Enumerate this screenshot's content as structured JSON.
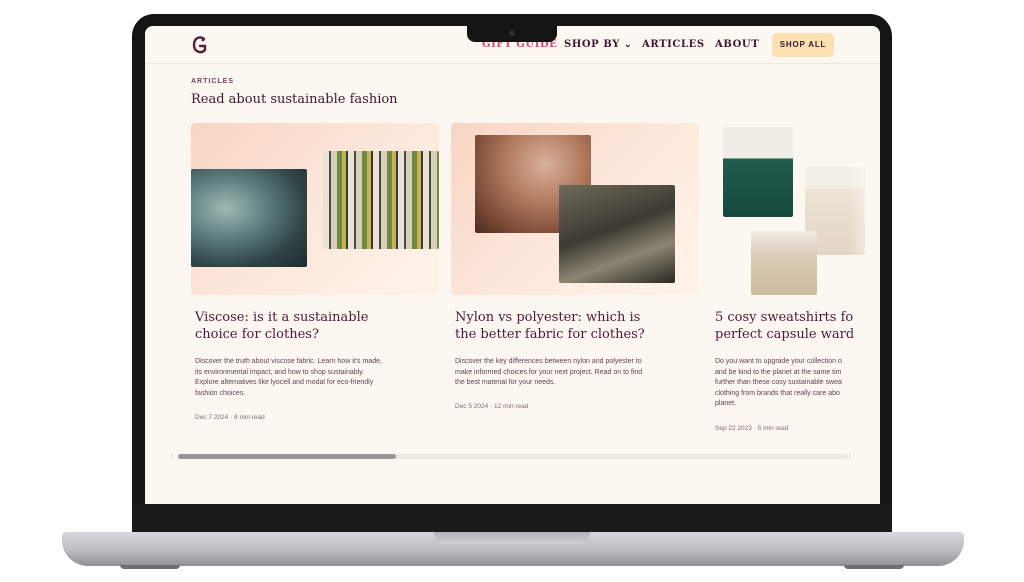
{
  "nav": {
    "items": [
      "GIFT GUIDE",
      "SHOP BY",
      "ARTICLES",
      "ABOUT"
    ],
    "cta": "SHOP ALL",
    "active_color": "#d9466f"
  },
  "section": {
    "eyebrow": "ARTICLES",
    "title": "Read about sustainable fashion"
  },
  "articles": [
    {
      "title": "Viscose: is it a sustainable\nchoice for clothes?",
      "excerpt": "Discover the truth about viscose fabric. Learn how it's made,\nits environmental impact, and how to shop sustainably.\nExplore alternatives like lyocell and modal for eco-friendly\nfashion choices.",
      "date": "Dec 7 2024",
      "read_time": "8 min read"
    },
    {
      "title": "Nylon vs polyester: which is\nthe better fabric for clothes?",
      "excerpt": "Discover the key differences between nylon and polyester to\nmake informed choices for your next project. Read on to find\nthe best material for your needs.",
      "date": "Dec 5 2024",
      "read_time": "12 min read"
    },
    {
      "title": "5 cosy sweatshirts fo\nperfect capsule ward",
      "excerpt": "Do you want to upgrade your collection o\nand be kind to the planet at the same tim\nfurther than these cosy sustainable swea\nclothing from brands that really care abo\nplanet.",
      "date": "Sep 22 2023",
      "read_time": "5 min read"
    }
  ],
  "icons": [
    "logo-icon",
    "chevron-down-icon",
    "scroll-left-icon",
    "scroll-right-icon"
  ],
  "colors": {
    "brand": "#5b1f3e",
    "cta_bg": "#fbe1b1",
    "background": "#fdf7f1"
  },
  "scroll": {
    "position": 0.33
  }
}
